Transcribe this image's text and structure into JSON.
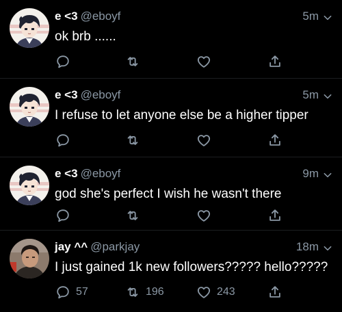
{
  "colors": {
    "background": "#000000",
    "text": "#ffffff",
    "secondary": "#8b98a5",
    "divider": "#1c1e20"
  },
  "tweets": [
    {
      "display_name": "e <3",
      "handle": "@eboyf",
      "time": "5m",
      "text": "ok brb ......",
      "avatar": "anime-boy-avatar",
      "reply_count": "",
      "retweet_count": "",
      "like_count": ""
    },
    {
      "display_name": "e <3",
      "handle": "@eboyf",
      "time": "5m",
      "text": "I refuse to let anyone else be a higher tipper",
      "avatar": "anime-boy-avatar",
      "reply_count": "",
      "retweet_count": "",
      "like_count": ""
    },
    {
      "display_name": "e <3",
      "handle": "@eboyf",
      "time": "9m",
      "text": "god she's perfect I wish he wasn't there",
      "avatar": "anime-boy-avatar",
      "reply_count": "",
      "retweet_count": "",
      "like_count": ""
    },
    {
      "display_name": "jay ^^",
      "handle": "@parkjay",
      "time": "18m",
      "text": "I just gained 1k new followers????? hello?????",
      "avatar": "photo-avatar",
      "reply_count": "57",
      "retweet_count": "196",
      "like_count": "243"
    }
  ]
}
